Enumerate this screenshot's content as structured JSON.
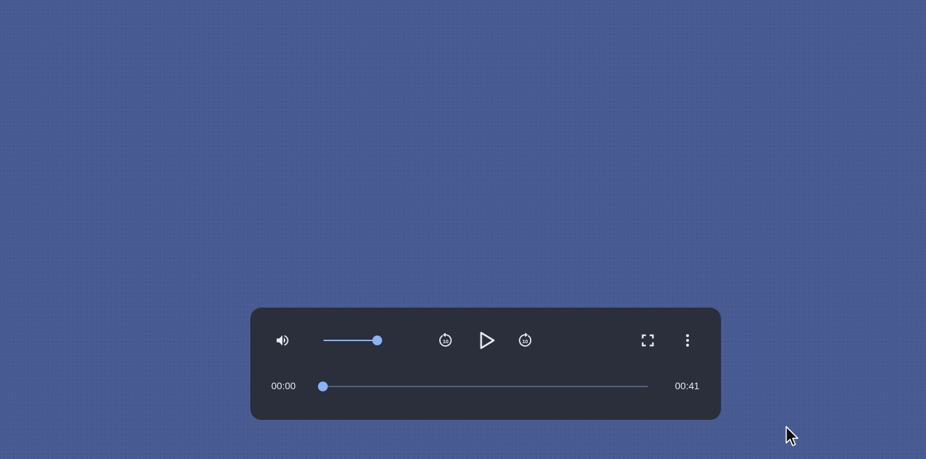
{
  "player": {
    "time_current": "00:00",
    "time_total": "00:41",
    "progress_fraction": 0.0,
    "volume_fraction": 1.0
  },
  "icons": {
    "volume": "volume-up-icon",
    "rewind": "replay-10-icon",
    "play": "play-icon",
    "forward": "forward-10-icon",
    "fullscreen": "fullscreen-icon",
    "more": "more-vert-icon",
    "rewind_label": "10",
    "forward_label": "10"
  },
  "colors": {
    "background": "#475a91",
    "panel": "#2b2f3c",
    "accent": "#8ab4f8",
    "track": "#51627f",
    "text": "#e8eaf0"
  }
}
